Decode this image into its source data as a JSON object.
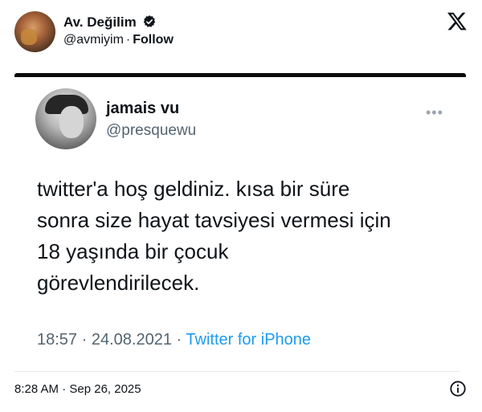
{
  "header": {
    "author_name": "Av. Değilim",
    "author_handle": "@avmiyim",
    "separator": "·",
    "follow_label": "Follow",
    "verified_color": "#0f1419"
  },
  "quoted": {
    "name": "jamais vu",
    "handle": "@presquewu",
    "more_label": "•••",
    "text": "twitter'a hoş geldiniz. kısa bir süre\nsonra size hayat tavsiyesi vermesi için\n18 yaşında bir çocuk\ngörevlendirilecek.",
    "time": "18:57",
    "date": "24.08.2021",
    "separator": "·",
    "source": "Twitter for iPhone",
    "source_color": "#1d9bf0"
  },
  "footer": {
    "timestamp": "8:28 AM · Sep 26, 2025"
  },
  "icons": {
    "logo": "x-logo-icon",
    "verified": "verified-badge-icon",
    "info": "info-icon",
    "more": "more-icon"
  }
}
